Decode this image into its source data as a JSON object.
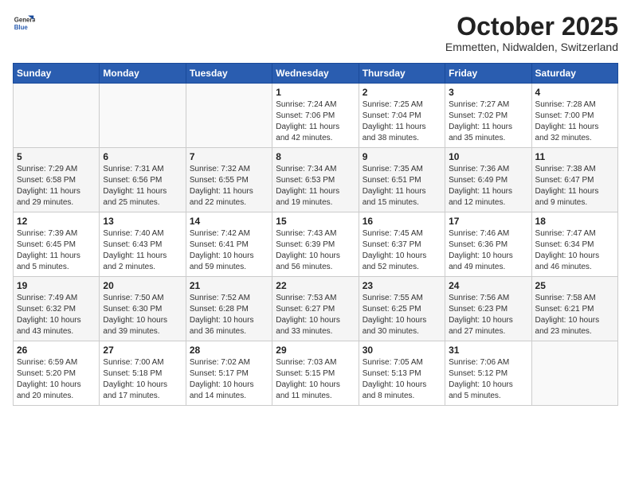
{
  "header": {
    "logo_general": "General",
    "logo_blue": "Blue",
    "month_title": "October 2025",
    "location": "Emmetten, Nidwalden, Switzerland"
  },
  "weekdays": [
    "Sunday",
    "Monday",
    "Tuesday",
    "Wednesday",
    "Thursday",
    "Friday",
    "Saturday"
  ],
  "weeks": [
    [
      {
        "day": "",
        "info": ""
      },
      {
        "day": "",
        "info": ""
      },
      {
        "day": "",
        "info": ""
      },
      {
        "day": "1",
        "info": "Sunrise: 7:24 AM\nSunset: 7:06 PM\nDaylight: 11 hours\nand 42 minutes."
      },
      {
        "day": "2",
        "info": "Sunrise: 7:25 AM\nSunset: 7:04 PM\nDaylight: 11 hours\nand 38 minutes."
      },
      {
        "day": "3",
        "info": "Sunrise: 7:27 AM\nSunset: 7:02 PM\nDaylight: 11 hours\nand 35 minutes."
      },
      {
        "day": "4",
        "info": "Sunrise: 7:28 AM\nSunset: 7:00 PM\nDaylight: 11 hours\nand 32 minutes."
      }
    ],
    [
      {
        "day": "5",
        "info": "Sunrise: 7:29 AM\nSunset: 6:58 PM\nDaylight: 11 hours\nand 29 minutes."
      },
      {
        "day": "6",
        "info": "Sunrise: 7:31 AM\nSunset: 6:56 PM\nDaylight: 11 hours\nand 25 minutes."
      },
      {
        "day": "7",
        "info": "Sunrise: 7:32 AM\nSunset: 6:55 PM\nDaylight: 11 hours\nand 22 minutes."
      },
      {
        "day": "8",
        "info": "Sunrise: 7:34 AM\nSunset: 6:53 PM\nDaylight: 11 hours\nand 19 minutes."
      },
      {
        "day": "9",
        "info": "Sunrise: 7:35 AM\nSunset: 6:51 PM\nDaylight: 11 hours\nand 15 minutes."
      },
      {
        "day": "10",
        "info": "Sunrise: 7:36 AM\nSunset: 6:49 PM\nDaylight: 11 hours\nand 12 minutes."
      },
      {
        "day": "11",
        "info": "Sunrise: 7:38 AM\nSunset: 6:47 PM\nDaylight: 11 hours\nand 9 minutes."
      }
    ],
    [
      {
        "day": "12",
        "info": "Sunrise: 7:39 AM\nSunset: 6:45 PM\nDaylight: 11 hours\nand 5 minutes."
      },
      {
        "day": "13",
        "info": "Sunrise: 7:40 AM\nSunset: 6:43 PM\nDaylight: 11 hours\nand 2 minutes."
      },
      {
        "day": "14",
        "info": "Sunrise: 7:42 AM\nSunset: 6:41 PM\nDaylight: 10 hours\nand 59 minutes."
      },
      {
        "day": "15",
        "info": "Sunrise: 7:43 AM\nSunset: 6:39 PM\nDaylight: 10 hours\nand 56 minutes."
      },
      {
        "day": "16",
        "info": "Sunrise: 7:45 AM\nSunset: 6:37 PM\nDaylight: 10 hours\nand 52 minutes."
      },
      {
        "day": "17",
        "info": "Sunrise: 7:46 AM\nSunset: 6:36 PM\nDaylight: 10 hours\nand 49 minutes."
      },
      {
        "day": "18",
        "info": "Sunrise: 7:47 AM\nSunset: 6:34 PM\nDaylight: 10 hours\nand 46 minutes."
      }
    ],
    [
      {
        "day": "19",
        "info": "Sunrise: 7:49 AM\nSunset: 6:32 PM\nDaylight: 10 hours\nand 43 minutes."
      },
      {
        "day": "20",
        "info": "Sunrise: 7:50 AM\nSunset: 6:30 PM\nDaylight: 10 hours\nand 39 minutes."
      },
      {
        "day": "21",
        "info": "Sunrise: 7:52 AM\nSunset: 6:28 PM\nDaylight: 10 hours\nand 36 minutes."
      },
      {
        "day": "22",
        "info": "Sunrise: 7:53 AM\nSunset: 6:27 PM\nDaylight: 10 hours\nand 33 minutes."
      },
      {
        "day": "23",
        "info": "Sunrise: 7:55 AM\nSunset: 6:25 PM\nDaylight: 10 hours\nand 30 minutes."
      },
      {
        "day": "24",
        "info": "Sunrise: 7:56 AM\nSunset: 6:23 PM\nDaylight: 10 hours\nand 27 minutes."
      },
      {
        "day": "25",
        "info": "Sunrise: 7:58 AM\nSunset: 6:21 PM\nDaylight: 10 hours\nand 23 minutes."
      }
    ],
    [
      {
        "day": "26",
        "info": "Sunrise: 6:59 AM\nSunset: 5:20 PM\nDaylight: 10 hours\nand 20 minutes."
      },
      {
        "day": "27",
        "info": "Sunrise: 7:00 AM\nSunset: 5:18 PM\nDaylight: 10 hours\nand 17 minutes."
      },
      {
        "day": "28",
        "info": "Sunrise: 7:02 AM\nSunset: 5:17 PM\nDaylight: 10 hours\nand 14 minutes."
      },
      {
        "day": "29",
        "info": "Sunrise: 7:03 AM\nSunset: 5:15 PM\nDaylight: 10 hours\nand 11 minutes."
      },
      {
        "day": "30",
        "info": "Sunrise: 7:05 AM\nSunset: 5:13 PM\nDaylight: 10 hours\nand 8 minutes."
      },
      {
        "day": "31",
        "info": "Sunrise: 7:06 AM\nSunset: 5:12 PM\nDaylight: 10 hours\nand 5 minutes."
      },
      {
        "day": "",
        "info": ""
      }
    ]
  ]
}
